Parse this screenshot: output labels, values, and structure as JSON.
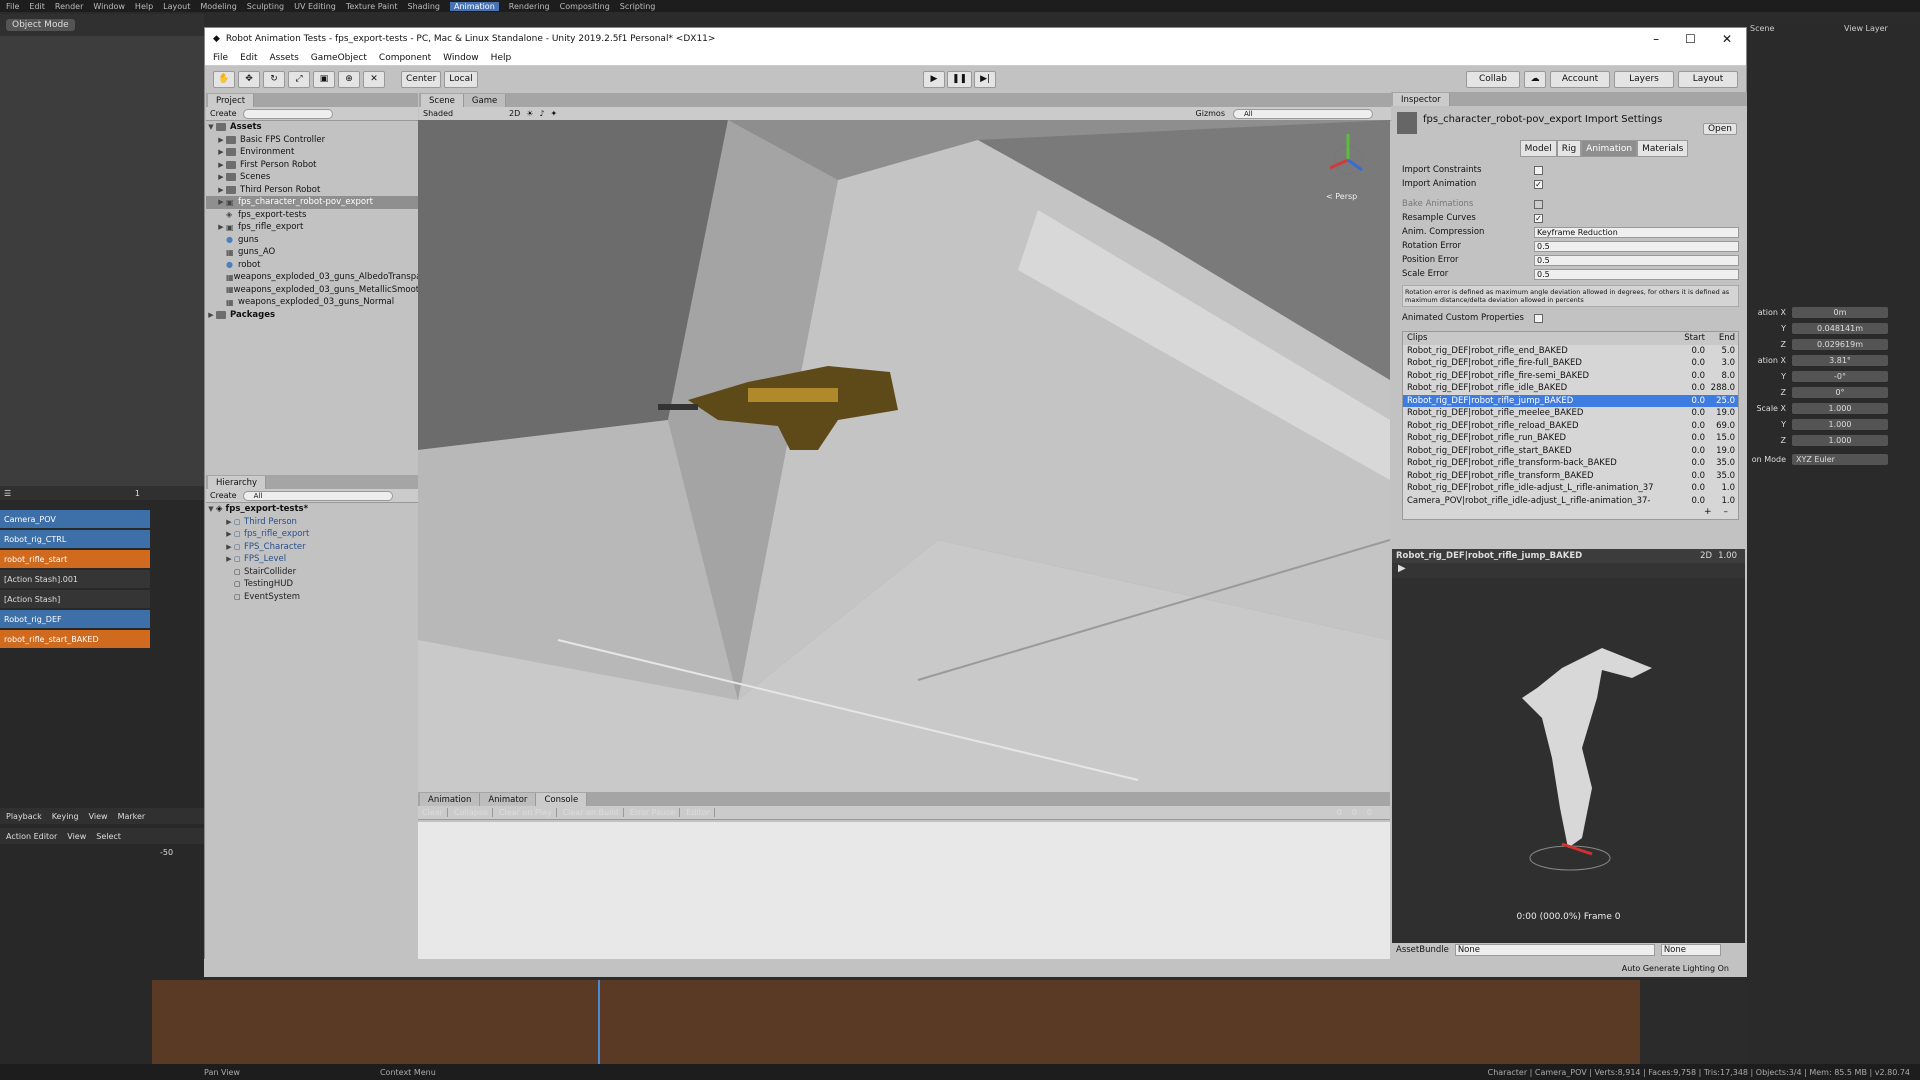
{
  "blender": {
    "top_menu": [
      "File",
      "Edit",
      "Render",
      "Window",
      "Help",
      "Layout",
      "Modeling",
      "Sculpting",
      "UV Editing",
      "Texture Paint",
      "Shading",
      "Animation",
      "Rendering",
      "Compositing",
      "Scripting"
    ],
    "active_workspace": "Animation",
    "scene_label": "Scene",
    "view_layer_label": "View Layer",
    "mode_label": "Object Mode",
    "tracks": [
      {
        "name": "Camera_POV",
        "style": "blue"
      },
      {
        "name": "Robot_rig_CTRL",
        "style": "blue"
      },
      {
        "name": "robot_rifle_start",
        "style": "orange"
      },
      {
        "name": "[Action Stash].001",
        "style": "dark"
      },
      {
        "name": "[Action Stash]",
        "style": "dark"
      },
      {
        "name": "Robot_rig_DEF",
        "style": "blue"
      },
      {
        "name": "robot_rifle_start_BAKED",
        "style": "orange"
      }
    ],
    "playback_menu": [
      "Playback",
      "Keying",
      "View",
      "Marker"
    ],
    "action_editor_label": "Action Editor",
    "action_menu": [
      "View",
      "Select"
    ],
    "frame_value": "-50",
    "frame_num": "1",
    "props": [
      {
        "label": "ation X",
        "value": "0m"
      },
      {
        "label": "Y",
        "value": "0.048141m"
      },
      {
        "label": "Z",
        "value": "0.029619m"
      },
      {
        "label": "ation X",
        "value": "3.81°"
      },
      {
        "label": "Y",
        "value": "-0°"
      },
      {
        "label": "Z",
        "value": "0°"
      },
      {
        "label": "Scale X",
        "value": "1.000"
      },
      {
        "label": "Y",
        "value": "1.000"
      },
      {
        "label": "Z",
        "value": "1.000"
      }
    ],
    "rot_mode_label": "on Mode",
    "rot_mode_value": "XYZ Euler",
    "status_left": "Pan View",
    "status_mid": "Context Menu",
    "status_right": "Character | Camera_POV | Verts:8,914 | Faces:9,758 | Tris:17,348 | Objects:3/4 | Mem: 85.5 MB | v2.80.74"
  },
  "unity": {
    "title": "Robot Animation Tests - fps_export-tests - PC, Mac & Linux Standalone - Unity 2019.2.5f1 Personal* <DX11>",
    "menu": [
      "File",
      "Edit",
      "Assets",
      "GameObject",
      "Component",
      "Window",
      "Help"
    ],
    "toolbar": {
      "center": "Center",
      "local": "Local",
      "collab": "Collab",
      "account": "Account",
      "layers": "Layers",
      "layout": "Layout"
    },
    "project": {
      "tab": "Project",
      "create": "Create",
      "assets_root": "Assets",
      "items": [
        {
          "name": "Basic FPS Controller",
          "type": "folder",
          "arrow": true
        },
        {
          "name": "Environment",
          "type": "folder",
          "arrow": true
        },
        {
          "name": "First Person Robot",
          "type": "folder",
          "arrow": true
        },
        {
          "name": "Scenes",
          "type": "folder",
          "arrow": true
        },
        {
          "name": "Third Person Robot",
          "type": "folder",
          "arrow": true
        },
        {
          "name": "fps_character_robot-pov_export",
          "type": "model",
          "arrow": true,
          "selected": true
        },
        {
          "name": "fps_export-tests",
          "type": "scene",
          "arrow": false
        },
        {
          "name": "fps_rifle_export",
          "type": "model",
          "arrow": true
        },
        {
          "name": "guns",
          "type": "material",
          "arrow": false
        },
        {
          "name": "guns_AO",
          "type": "texture",
          "arrow": false
        },
        {
          "name": "robot",
          "type": "material",
          "arrow": false
        },
        {
          "name": "weapons_exploded_03_guns_AlbedoTransparency",
          "type": "texture",
          "arrow": false
        },
        {
          "name": "weapons_exploded_03_guns_MetallicSmoothness",
          "type": "texture",
          "arrow": false
        },
        {
          "name": "weapons_exploded_03_guns_Normal",
          "type": "texture",
          "arrow": false
        }
      ],
      "packages": "Packages"
    },
    "hierarchy": {
      "tab": "Hierarchy",
      "create": "Create",
      "search": "All",
      "scene": "fps_export-tests*",
      "items": [
        "Third Person",
        "fps_rifle_export",
        "FPS_Character",
        "FPS_Level",
        "StairCollider",
        "TestingHUD",
        "EventSystem"
      ]
    },
    "scene_view": {
      "tab_scene": "Scene",
      "tab_game": "Game",
      "shading": "Shaded",
      "mode2d": "2D",
      "gizmos": "Gizmos",
      "search": "All",
      "persp": "< Persp"
    },
    "console": {
      "tabs": [
        "Animation",
        "Animator",
        "Console"
      ],
      "buttons": [
        "Clear",
        "Collapse",
        "Clear on Play",
        "Clear on Build",
        "Error Pause",
        "Editor"
      ],
      "counts": [
        "0",
        "0",
        "0"
      ]
    },
    "inspector": {
      "tab": "Inspector",
      "title": "fps_character_robot-pov_export Import Settings",
      "open": "Open",
      "tabs": [
        "Model",
        "Rig",
        "Animation",
        "Materials"
      ],
      "import_constraints": "Import Constraints",
      "import_animation": "Import Animation",
      "bake_animations": "Bake Animations",
      "resample_curves": "Resample Curves",
      "anim_compression": "Anim. Compression",
      "anim_compression_value": "Keyframe Reduction",
      "rotation_error": "Rotation Error",
      "rotation_error_value": "0.5",
      "position_error": "Position Error",
      "position_error_value": "0.5",
      "scale_error": "Scale Error",
      "scale_error_value": "0.5",
      "help": "Rotation error is defined as maximum angle deviation allowed in degrees, for others it is defined as maximum distance/delta deviation allowed in percents",
      "animated_custom": "Animated Custom Properties",
      "clips_hdr": {
        "name": "Clips",
        "start": "Start",
        "end": "End"
      },
      "clips": [
        {
          "name": "Robot_rig_DEF|robot_rifle_end_BAKED",
          "start": "0.0",
          "end": "5.0"
        },
        {
          "name": "Robot_rig_DEF|robot_rifle_fire-full_BAKED",
          "start": "0.0",
          "end": "3.0"
        },
        {
          "name": "Robot_rig_DEF|robot_rifle_fire-semi_BAKED",
          "start": "0.0",
          "end": "8.0"
        },
        {
          "name": "Robot_rig_DEF|robot_rifle_idle_BAKED",
          "start": "0.0",
          "end": "288.0"
        },
        {
          "name": "Robot_rig_DEF|robot_rifle_jump_BAKED",
          "start": "0.0",
          "end": "25.0",
          "selected": true
        },
        {
          "name": "Robot_rig_DEF|robot_rifle_meelee_BAKED",
          "start": "0.0",
          "end": "19.0"
        },
        {
          "name": "Robot_rig_DEF|robot_rifle_reload_BAKED",
          "start": "0.0",
          "end": "69.0"
        },
        {
          "name": "Robot_rig_DEF|robot_rifle_run_BAKED",
          "start": "0.0",
          "end": "15.0"
        },
        {
          "name": "Robot_rig_DEF|robot_rifle_start_BAKED",
          "start": "0.0",
          "end": "19.0"
        },
        {
          "name": "Robot_rig_DEF|robot_rifle_transform-back_BAKED",
          "start": "0.0",
          "end": "35.0"
        },
        {
          "name": "Robot_rig_DEF|robot_rifle_transform_BAKED",
          "start": "0.0",
          "end": "35.0"
        },
        {
          "name": "Robot_rig_DEF|robot_rifle_idle-adjust_L_rifle-animation_37",
          "start": "0.0",
          "end": "1.0"
        },
        {
          "name": "Camera_POV|robot_rifle_idle-adjust_L_rifle-animation_37-",
          "start": "0.0",
          "end": "1.0"
        }
      ],
      "preview_clip": "Robot_rig_DEF|robot_rifle_jump_BAKED",
      "preview_speed": "1.00",
      "preview_2d": "2D",
      "preview_time": "0:00 (000.0%) Frame 0",
      "assetbundle_label": "AssetBundle",
      "assetbundle_value": "None",
      "assetbundle_variant": "None",
      "auto_lighting": "Auto Generate Lighting On"
    }
  }
}
